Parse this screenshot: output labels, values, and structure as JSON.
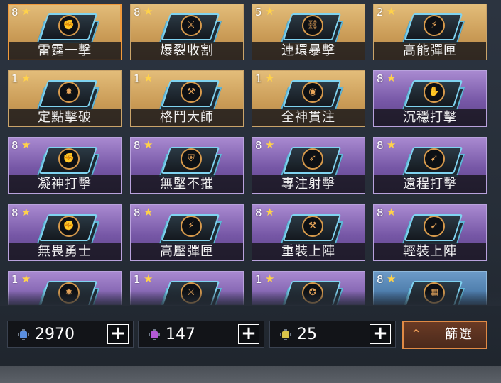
{
  "cards": [
    {
      "count": "8",
      "name": "雷霆一擊",
      "tier": "gold",
      "icon": "bolt-fist-icon",
      "glyph": "✊",
      "selected": true
    },
    {
      "count": "8",
      "name": "爆裂收割",
      "tier": "gold",
      "icon": "scythe-icon",
      "glyph": "⚔",
      "selected": false
    },
    {
      "count": "5",
      "name": "連環暴擊",
      "tier": "gold",
      "icon": "chain-icon",
      "glyph": "⛓",
      "selected": false
    },
    {
      "count": "2",
      "name": "高能彈匣",
      "tier": "gold",
      "icon": "energy-magazine-icon",
      "glyph": "⚡",
      "selected": false
    },
    {
      "count": "1",
      "name": "定點擊破",
      "tier": "gold",
      "icon": "burst-icon",
      "glyph": "✸",
      "selected": false
    },
    {
      "count": "1",
      "name": "格鬥大師",
      "tier": "gold",
      "icon": "blade-icon",
      "glyph": "⚒",
      "selected": false
    },
    {
      "count": "1",
      "name": "全神貫注",
      "tier": "gold",
      "icon": "eye-icon",
      "glyph": "◉",
      "selected": false
    },
    {
      "count": "8",
      "name": "沉穩打擊",
      "tier": "purple",
      "icon": "hand-icon",
      "glyph": "✋",
      "selected": false
    },
    {
      "count": "8",
      "name": "凝神打擊",
      "tier": "purple",
      "icon": "arm-icon",
      "glyph": "✊",
      "selected": false
    },
    {
      "count": "8",
      "name": "無堅不摧",
      "tier": "purple",
      "icon": "shield-break-icon",
      "glyph": "⛨",
      "selected": false
    },
    {
      "count": "8",
      "name": "專注射擊",
      "tier": "purple",
      "icon": "bullet-icon",
      "glyph": "➶",
      "selected": false
    },
    {
      "count": "8",
      "name": "遠程打擊",
      "tier": "purple",
      "icon": "long-range-icon",
      "glyph": "➹",
      "selected": false
    },
    {
      "count": "8",
      "name": "無畏勇士",
      "tier": "purple",
      "icon": "warrior-icon",
      "glyph": "✊",
      "selected": false
    },
    {
      "count": "8",
      "name": "高壓彈匣",
      "tier": "purple",
      "icon": "pressure-magazine-icon",
      "glyph": "⚡",
      "selected": false
    },
    {
      "count": "8",
      "name": "重裝上陣",
      "tier": "purple",
      "icon": "heavy-gun-icon",
      "glyph": "⚒",
      "selected": false
    },
    {
      "count": "8",
      "name": "輕裝上陣",
      "tier": "purple",
      "icon": "light-gun-icon",
      "glyph": "➹",
      "selected": false
    },
    {
      "count": "1",
      "name": "",
      "tier": "purple",
      "icon": "gear-star-icon",
      "glyph": "✹",
      "selected": false
    },
    {
      "count": "1",
      "name": "",
      "tier": "purple",
      "icon": "bullets-icon",
      "glyph": "⚔",
      "selected": false
    },
    {
      "count": "1",
      "name": "",
      "tier": "purple",
      "icon": "helmet-icon",
      "glyph": "✪",
      "selected": false
    },
    {
      "count": "8",
      "name": "",
      "tier": "blue",
      "icon": "armor-icon",
      "glyph": "▦",
      "selected": false
    }
  ],
  "resources": [
    {
      "value": "2970",
      "icon": "blue-chip-icon",
      "color": "#5a8fe0"
    },
    {
      "value": "147",
      "icon": "purple-chip-icon",
      "color": "#b45ad6"
    },
    {
      "value": "25",
      "icon": "gold-chip-icon",
      "color": "#d8c34a"
    }
  ],
  "filter": {
    "label": "篩選",
    "icon": "filter-chevron-icon"
  }
}
